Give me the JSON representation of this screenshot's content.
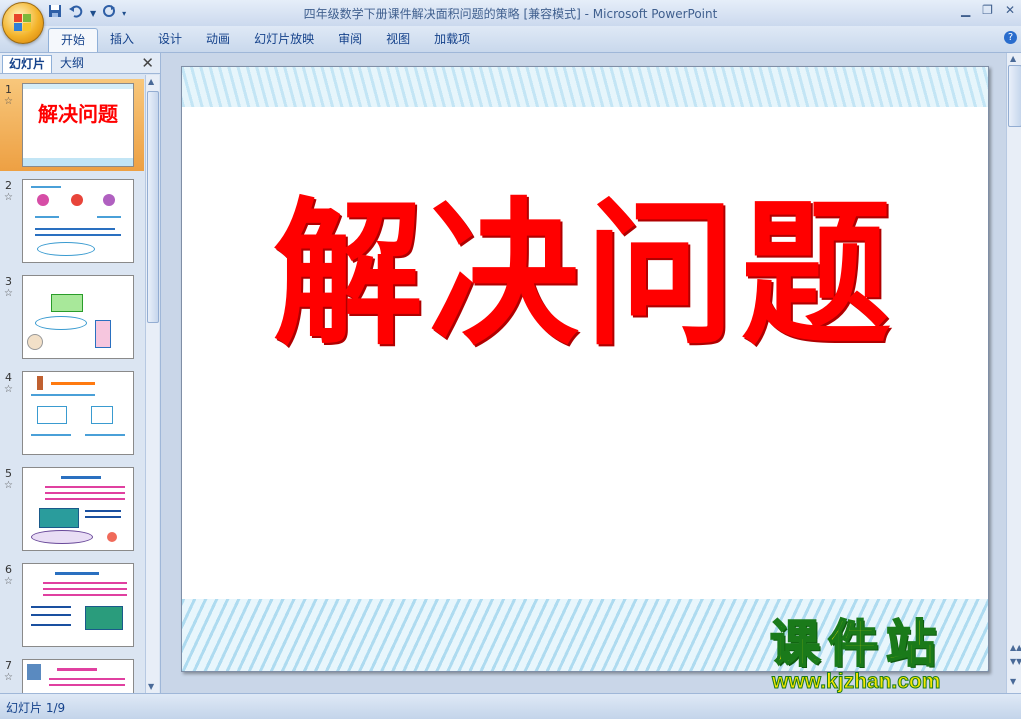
{
  "window": {
    "title": "四年级数学下册课件解决面积问题的策略 [兼容模式] - Microsoft PowerPoint"
  },
  "ribbon": {
    "tabs": [
      "开始",
      "插入",
      "设计",
      "动画",
      "幻灯片放映",
      "审阅",
      "视图",
      "加载项"
    ],
    "active": "开始"
  },
  "pane": {
    "tab_slides": "幻灯片",
    "tab_outline": "大纲",
    "slides": [
      {
        "num": "1",
        "title": "解决问题",
        "selected": true
      },
      {
        "num": "2"
      },
      {
        "num": "3"
      },
      {
        "num": "4"
      },
      {
        "num": "5"
      },
      {
        "num": "6"
      },
      {
        "num": "7"
      }
    ]
  },
  "slide": {
    "title": "解决问题",
    "title_color": "#ff0000"
  },
  "watermark": {
    "name": "课件站",
    "url": "www.kjzhan.com"
  },
  "status": {
    "slide_count": "幻灯片 1/9"
  },
  "icons": [
    "office-button",
    "save-icon",
    "undo-icon",
    "redo-icon",
    "customize-qat-icon",
    "minimize-icon",
    "restore-icon",
    "close-icon",
    "help-icon",
    "pane-close-icon",
    "star-icon"
  ]
}
